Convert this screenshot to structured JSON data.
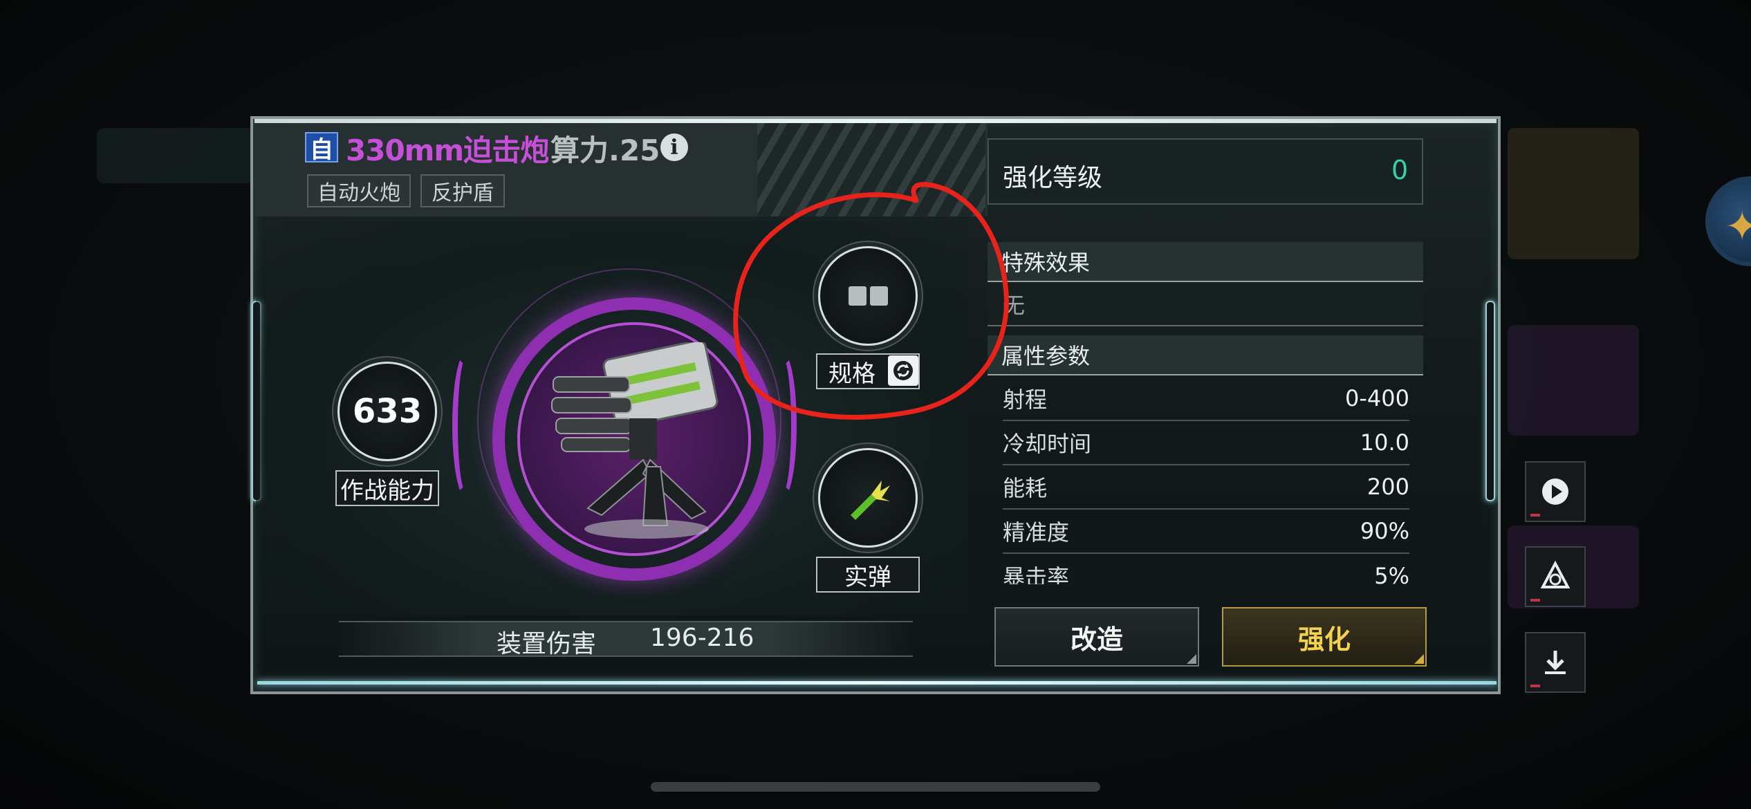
{
  "weapon": {
    "type_tag": "自",
    "name": "330mm迫击炮",
    "power_label": "算力.25",
    "tags": [
      "自动火炮",
      "反护盾"
    ]
  },
  "combat": {
    "value": "633",
    "label": "作战能力"
  },
  "spec": {
    "label": "规格"
  },
  "ammo": {
    "label": "实弹"
  },
  "damage": {
    "label": "装置伤害",
    "value": "196-216"
  },
  "enhance_level": {
    "label": "强化等级",
    "value": "0"
  },
  "special_effects": {
    "title": "特殊效果",
    "value": "无"
  },
  "attributes": {
    "title": "属性参数",
    "rows": [
      {
        "name": "射程",
        "value": "0-400"
      },
      {
        "name": "冷却时间",
        "value": "10.0"
      },
      {
        "name": "能耗",
        "value": "200"
      },
      {
        "name": "精准度",
        "value": "90%"
      },
      {
        "name": "暴击率",
        "value": "5%"
      }
    ]
  },
  "buttons": {
    "modify": "改造",
    "enhance": "强化"
  },
  "colors": {
    "weapon_name": "#c64fd8",
    "enhance_value": "#38d0a6",
    "enhance_button_text": "#f2d24e",
    "annotation": "#e8231c"
  }
}
